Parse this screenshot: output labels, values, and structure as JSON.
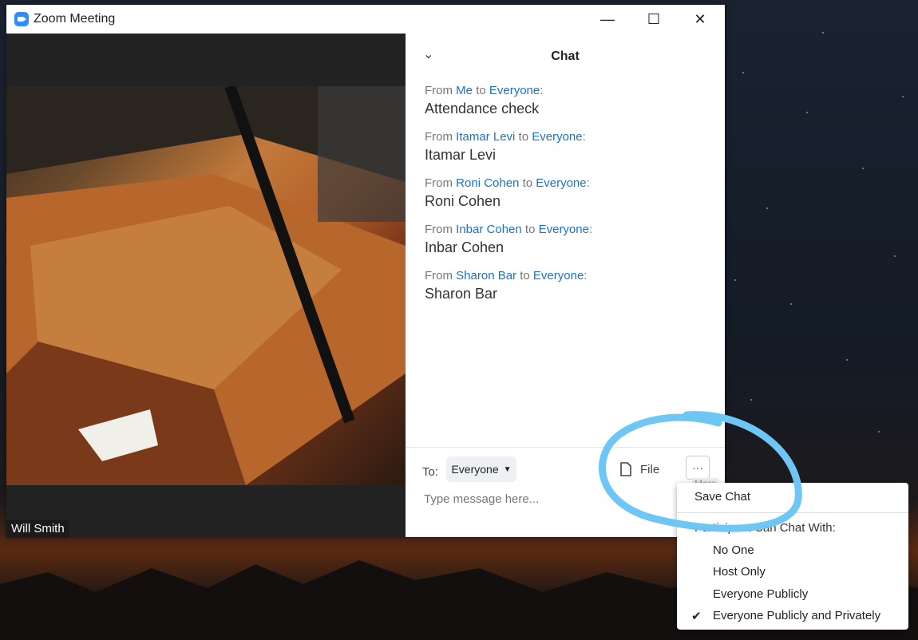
{
  "window": {
    "title": "Zoom Meeting",
    "app_icon": "zoom-icon",
    "minimize": "—",
    "maximize": "☐",
    "close": "✕"
  },
  "video": {
    "participant_name": "Will Smith"
  },
  "chat": {
    "title": "Chat",
    "messages": [
      {
        "from": "From",
        "sender": "Me",
        "to": "to",
        "recipient": "Everyone",
        "colon": ":",
        "text": "Attendance check"
      },
      {
        "from": "From",
        "sender": "Itamar Levi",
        "to": "to",
        "recipient": "Everyone",
        "colon": ":",
        "text": "Itamar Levi"
      },
      {
        "from": "From",
        "sender": "Roni Cohen",
        "to": "to",
        "recipient": "Everyone",
        "colon": ":",
        "text": "Roni Cohen"
      },
      {
        "from": "From",
        "sender": "Inbar Cohen",
        "to": "to",
        "recipient": "Everyone",
        "colon": ":",
        "text": "Inbar Cohen"
      },
      {
        "from": "From",
        "sender": "Sharon Bar",
        "to": "to",
        "recipient": "Everyone",
        "colon": ":",
        "text": "Sharon Bar"
      }
    ],
    "to_label": "To:",
    "to_value": "Everyone",
    "file_label": "File",
    "more_label": "···",
    "more_tooltip": "More",
    "input_placeholder": "Type message here..."
  },
  "menu": {
    "save_chat": "Save Chat",
    "section_label": "Participant Can Chat With:",
    "options": [
      "No One",
      "Host Only",
      "Everyone Publicly",
      "Everyone Publicly and Privately"
    ],
    "checkmark": "✔"
  },
  "colors": {
    "link": "#1a73c8",
    "annotation": "#6ec6f5",
    "zoom_blue": "#2d8cff"
  }
}
